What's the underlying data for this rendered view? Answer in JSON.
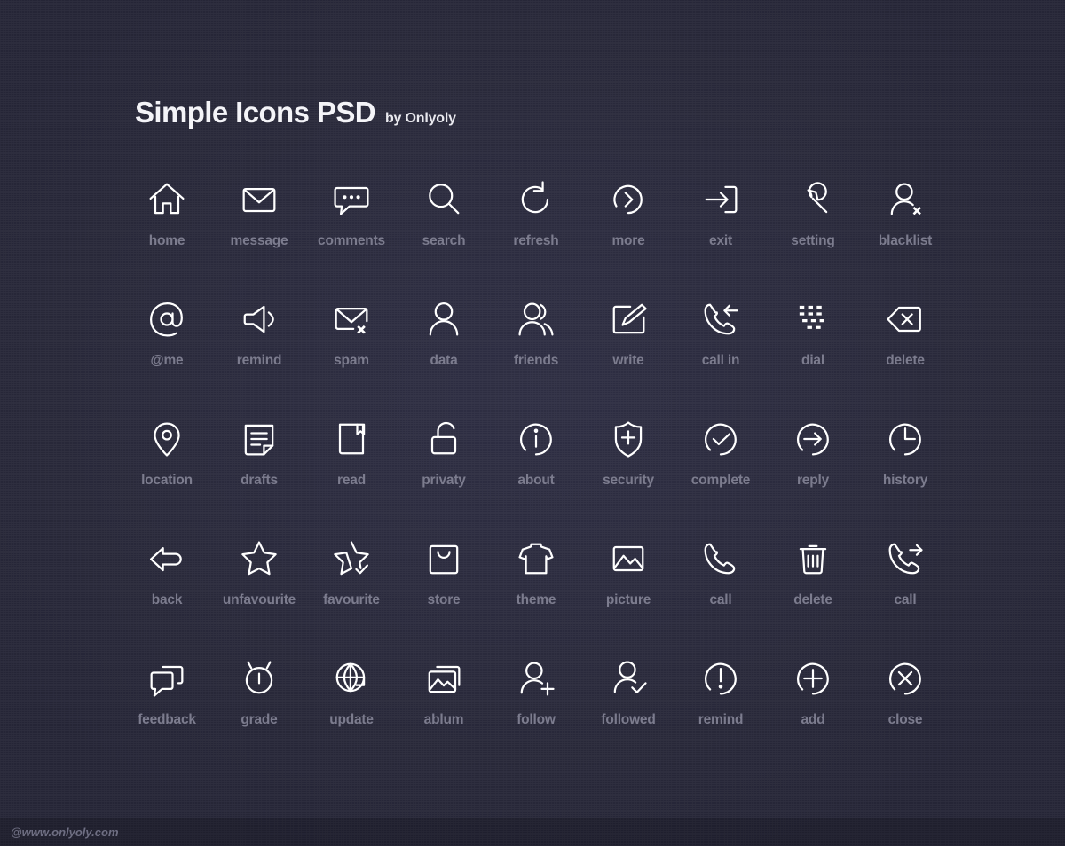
{
  "header": {
    "title": "Simple Icons PSD",
    "subtitle": "by Onlyoly"
  },
  "footer": {
    "watermark": "@www.onlyoly.com"
  },
  "colors": {
    "background": "#262639",
    "background_center": "#2e2e43",
    "icon": "#ffffff",
    "label": "#7c7c8e",
    "title": "#f4f4f8",
    "footer_text": "#6e6e82"
  },
  "grid": {
    "columns": 9,
    "rows": 5,
    "count": 45
  },
  "icons": [
    {
      "label": "home",
      "icon": "home-icon"
    },
    {
      "label": "message",
      "icon": "envelope-icon"
    },
    {
      "label": "comments",
      "icon": "comment-bubble-icon"
    },
    {
      "label": "search",
      "icon": "magnifier-icon"
    },
    {
      "label": "refresh",
      "icon": "refresh-arrow-icon"
    },
    {
      "label": "more",
      "icon": "chevron-right-circle-icon"
    },
    {
      "label": "exit",
      "icon": "exit-arrow-icon"
    },
    {
      "label": "setting",
      "icon": "wrench-icon"
    },
    {
      "label": "blacklist",
      "icon": "person-x-icon"
    },
    {
      "label": "@me",
      "icon": "at-sign-icon"
    },
    {
      "label": "remind",
      "icon": "megaphone-icon"
    },
    {
      "label": "spam",
      "icon": "envelope-x-icon"
    },
    {
      "label": "data",
      "icon": "person-icon"
    },
    {
      "label": "friends",
      "icon": "people-icon"
    },
    {
      "label": "write",
      "icon": "pencil-square-icon"
    },
    {
      "label": "call in",
      "icon": "phone-incoming-icon"
    },
    {
      "label": "dial",
      "icon": "dial-lines-icon"
    },
    {
      "label": "delete",
      "icon": "backspace-icon"
    },
    {
      "label": "location",
      "icon": "map-pin-icon"
    },
    {
      "label": "drafts",
      "icon": "document-lines-icon"
    },
    {
      "label": "read",
      "icon": "book-icon"
    },
    {
      "label": "privaty",
      "icon": "unlock-icon"
    },
    {
      "label": "about",
      "icon": "info-circle-icon"
    },
    {
      "label": "security",
      "icon": "shield-plus-icon"
    },
    {
      "label": "complete",
      "icon": "check-circle-icon"
    },
    {
      "label": "reply",
      "icon": "arrow-right-circle-icon"
    },
    {
      "label": "history",
      "icon": "clock-icon"
    },
    {
      "label": "back",
      "icon": "back-arrow-icon"
    },
    {
      "label": "unfavourite",
      "icon": "star-outline-icon"
    },
    {
      "label": "favourite",
      "icon": "star-check-icon"
    },
    {
      "label": "store",
      "icon": "shopping-bag-icon"
    },
    {
      "label": "theme",
      "icon": "tshirt-icon"
    },
    {
      "label": "picture",
      "icon": "image-icon"
    },
    {
      "label": "call",
      "icon": "phone-icon"
    },
    {
      "label": "delete",
      "icon": "trash-icon"
    },
    {
      "label": "call",
      "icon": "phone-outgoing-icon"
    },
    {
      "label": "feedback",
      "icon": "chat-bubbles-icon"
    },
    {
      "label": "grade",
      "icon": "timer-icon"
    },
    {
      "label": "update",
      "icon": "globe-arrow-icon"
    },
    {
      "label": "ablum",
      "icon": "photo-stack-icon"
    },
    {
      "label": "follow",
      "icon": "person-plus-icon"
    },
    {
      "label": "followed",
      "icon": "person-check-icon"
    },
    {
      "label": "remind",
      "icon": "exclamation-circle-icon"
    },
    {
      "label": "add",
      "icon": "plus-circle-icon"
    },
    {
      "label": "close",
      "icon": "x-circle-icon"
    }
  ]
}
